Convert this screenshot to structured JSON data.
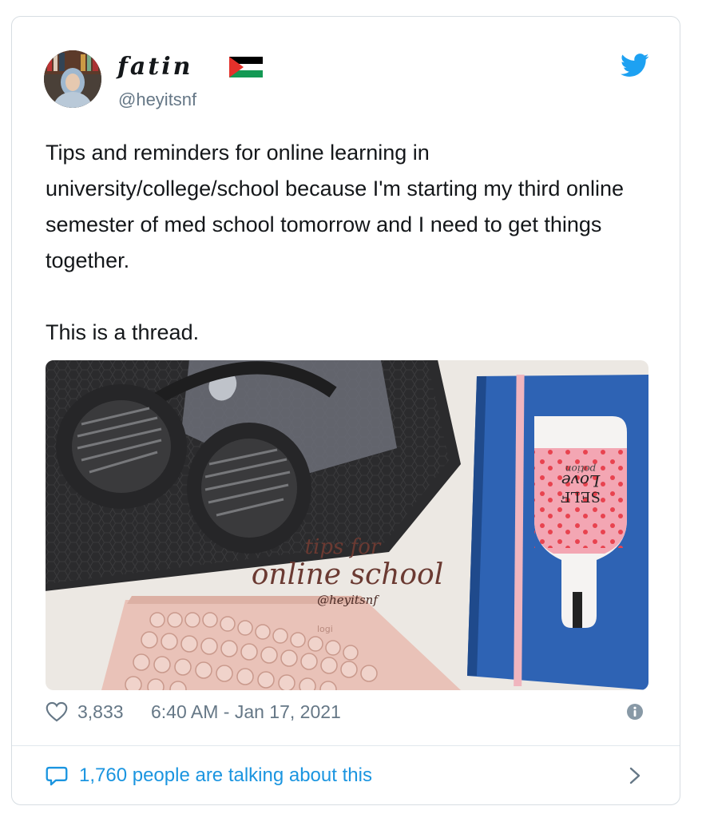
{
  "tweet": {
    "display_name": "fatin",
    "flag_icon": "palestine-flag-icon",
    "handle": "@heyitsnf",
    "brand_icon": "twitter-bird-icon",
    "text_paragraphs": [
      "Tips and reminders for online learning in university/college/school because I'm starting my third online semester of med school tomorrow and I need to get things together.",
      "This is a thread."
    ],
    "image": {
      "overlay_line1": "tips for",
      "overlay_line2": "online school",
      "overlay_handle": "@heyitsnf",
      "notebook_text": "SELF",
      "notebook_text2": "Love",
      "notebook_text3": "potion",
      "keyboard_brand": "logi"
    },
    "like_count": "3,833",
    "timestamp": "6:40 AM - Jan 17, 2021",
    "talking_label": "1,760 people are talking about this"
  },
  "colors": {
    "accent": "#1da1f2",
    "link": "#1b95e0",
    "text": "#14171a",
    "muted": "#657786",
    "border": "#d7dde2"
  }
}
